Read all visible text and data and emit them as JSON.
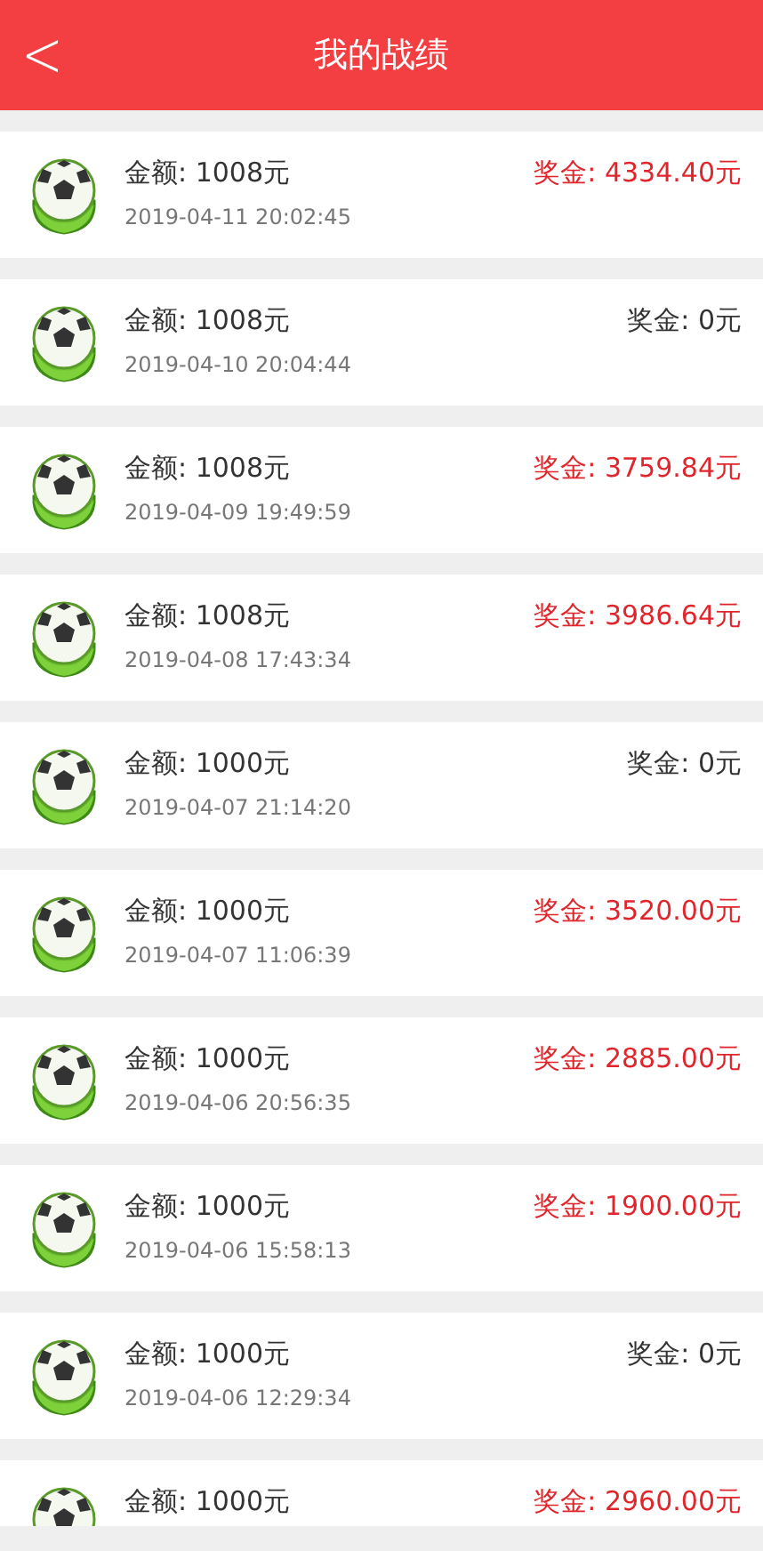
{
  "header": {
    "back": "<",
    "title": "我的战绩"
  },
  "records": [
    {
      "amount": "金额: 1008元",
      "prize": "奖金: 4334.40元",
      "won": true,
      "time": "2019-04-11 20:02:45"
    },
    {
      "amount": "金额: 1008元",
      "prize": "奖金: 0元",
      "won": false,
      "time": "2019-04-10 20:04:44"
    },
    {
      "amount": "金额: 1008元",
      "prize": "奖金: 3759.84元",
      "won": true,
      "time": "2019-04-09 19:49:59"
    },
    {
      "amount": "金额: 1008元",
      "prize": "奖金: 3986.64元",
      "won": true,
      "time": "2019-04-08 17:43:34"
    },
    {
      "amount": "金额: 1000元",
      "prize": "奖金: 0元",
      "won": false,
      "time": "2019-04-07 21:14:20"
    },
    {
      "amount": "金额: 1000元",
      "prize": "奖金: 3520.00元",
      "won": true,
      "time": "2019-04-07 11:06:39"
    },
    {
      "amount": "金额: 1000元",
      "prize": "奖金: 2885.00元",
      "won": true,
      "time": "2019-04-06 20:56:35"
    },
    {
      "amount": "金额: 1000元",
      "prize": "奖金: 1900.00元",
      "won": true,
      "time": "2019-04-06 15:58:13"
    },
    {
      "amount": "金额: 1000元",
      "prize": "奖金: 0元",
      "won": false,
      "time": "2019-04-06 12:29:34"
    },
    {
      "amount": "金额: 1000元",
      "prize": "奖金: 2960.00元",
      "won": true
    }
  ]
}
